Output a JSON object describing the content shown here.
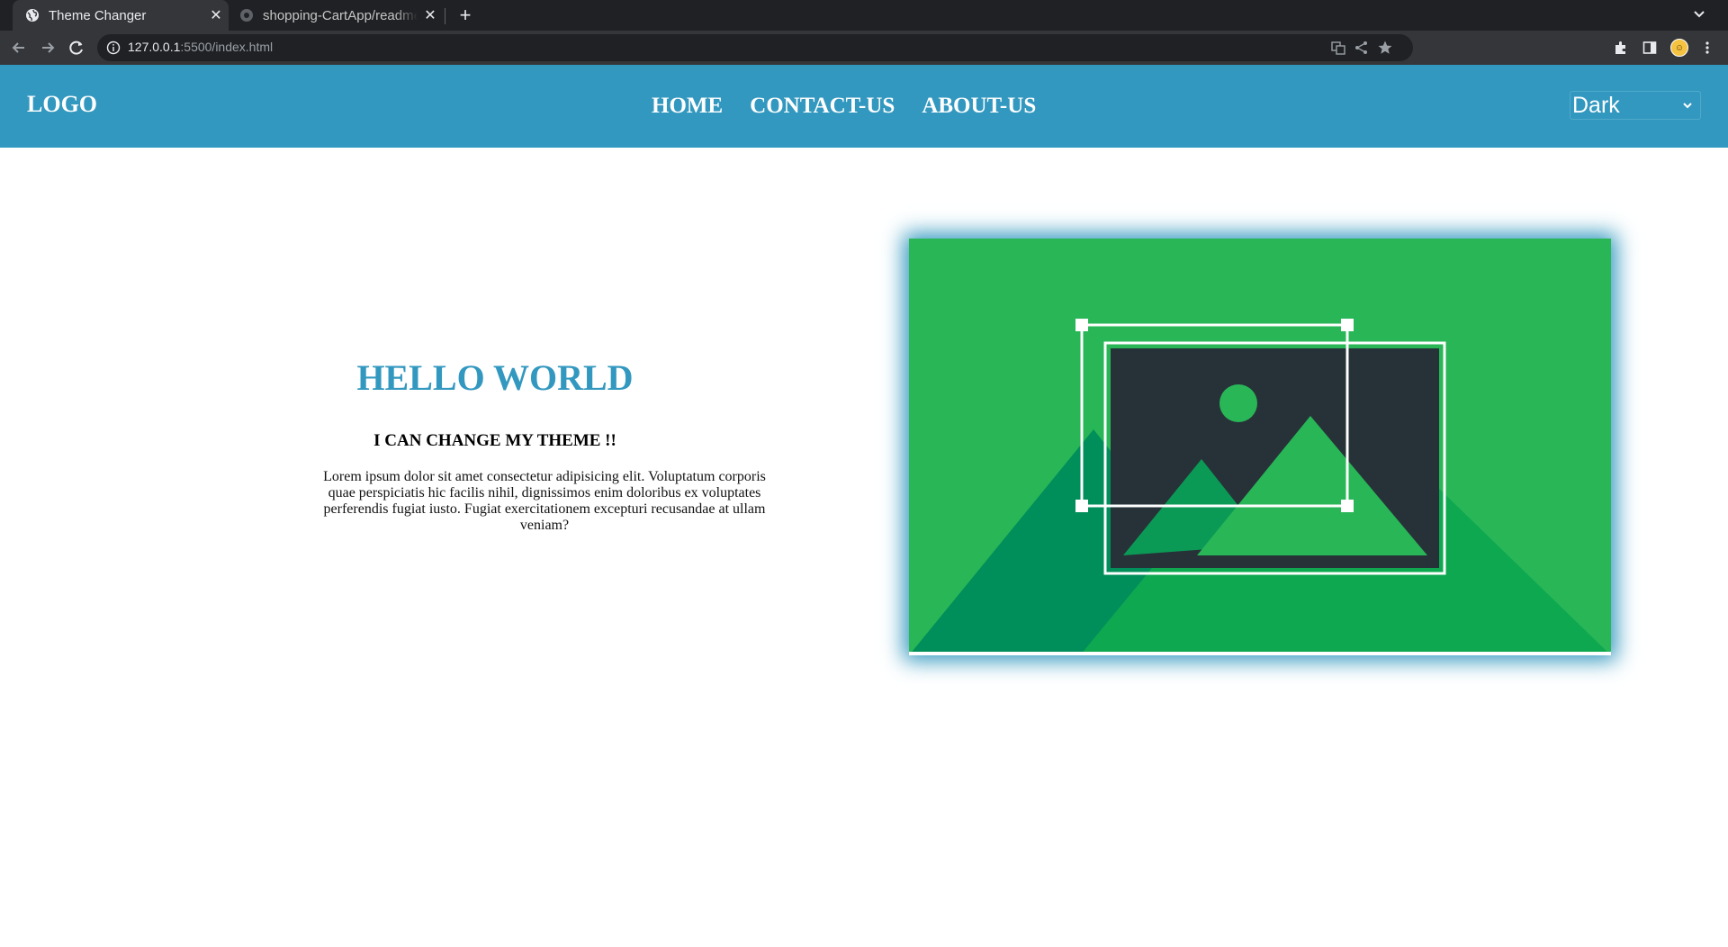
{
  "browser": {
    "tabs": [
      {
        "title": "Theme Changer",
        "active": true,
        "icon": "globe-icon"
      },
      {
        "title": "shopping-CartApp/readme",
        "active": false,
        "icon": "github-icon"
      }
    ],
    "url_host": "127.0.0.1",
    "url_rest": ":5500/index.html"
  },
  "header": {
    "logo": "LOGO",
    "nav": [
      "HOME",
      "CONTACT-US",
      "ABOUT-US"
    ],
    "theme_select": {
      "value": "Dark"
    }
  },
  "hero": {
    "title": "HELLO WORLD",
    "subtitle": "I CAN CHANGE MY THEME !!",
    "body": "Lorem ipsum dolor sit amet consectetur adipisicing elit. Voluptatum corporis quae perspiciatis hic facilis nihil, dignissimos enim doloribus ex voluptates perferendis fugiat iusto. Fugiat exercitationem excepturi recusandae at ullam veniam?"
  },
  "colors": {
    "header_bg": "#3398bf",
    "title_color": "#3398bf",
    "illustration_green": "#29b657",
    "illustration_dark": "#263238"
  }
}
